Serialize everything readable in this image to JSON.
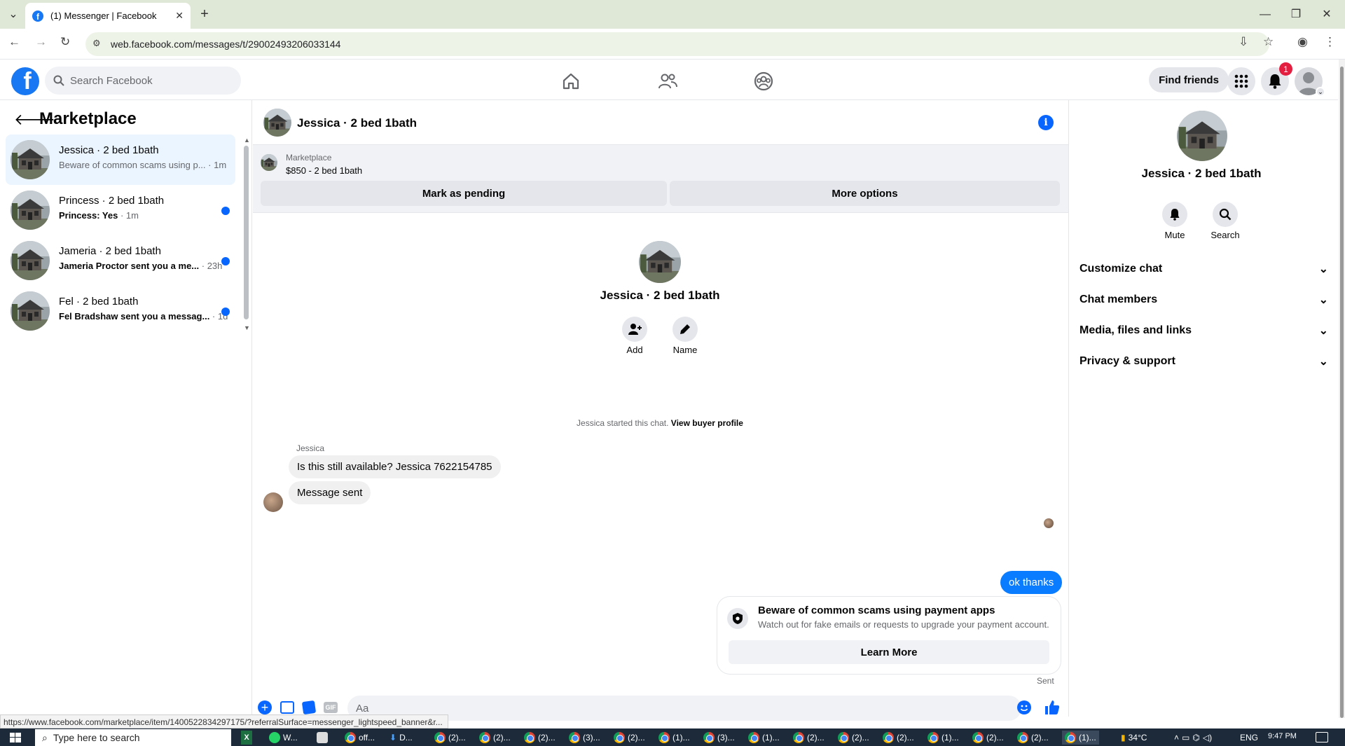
{
  "browser": {
    "tab_title": "(1) Messenger | Facebook",
    "url": "web.facebook.com/messages/t/29002493206033144",
    "status_url": "https://www.facebook.com/marketplace/item/1400522834297175/?referralSurface=messenger_lightspeed_banner&r..."
  },
  "header": {
    "search_placeholder": "Search Facebook",
    "find_friends": "Find friends",
    "notif_count": "1"
  },
  "left": {
    "title": "Marketplace",
    "conversations": [
      {
        "name": "Jessica · 2 bed 1bath",
        "snippet": "Beware of common scams using p...",
        "time": " · 1m",
        "unread": false
      },
      {
        "name": "Princess · 2 bed 1bath",
        "snippet": "Princess: Yes",
        "time": " · 1m",
        "unread": true
      },
      {
        "name": "Jameria · 2 bed 1bath",
        "snippet": "Jameria Proctor sent you a me...",
        "time": " · 23h",
        "unread": true
      },
      {
        "name": "Fel · 2 bed 1bath",
        "snippet": "Fel Bradshaw sent you a messag...",
        "time": " · 1d",
        "unread": true
      }
    ]
  },
  "chat": {
    "title": "Jessica · 2 bed 1bath",
    "banner_label": "Marketplace",
    "banner_listing": "$850 - 2 bed 1bath",
    "mark_pending": "Mark as pending",
    "more_options": "More options",
    "profile_name": "Jessica · 2 bed 1bath",
    "add_label": "Add",
    "name_label": "Name",
    "started_text": "Jessica started this chat.",
    "view_buyer": "View buyer profile",
    "sender": "Jessica",
    "msg1": "Is this still available? Jessica 7622154785",
    "msg2": "Message sent",
    "my_msg": "ok thanks",
    "scam_title": "Beware of common scams using payment apps",
    "scam_body": "Watch out for fake emails or requests to upgrade your payment account.",
    "learn_more": "Learn More",
    "sent": "Sent",
    "composer_placeholder": "Aa"
  },
  "right": {
    "name": "Jessica · 2 bed 1bath",
    "mute": "Mute",
    "search": "Search",
    "sections": [
      "Customize chat",
      "Chat members",
      "Media, files and links",
      "Privacy & support"
    ]
  },
  "taskbar": {
    "search_placeholder": "Type here to search",
    "apps": [
      "W...",
      "off...",
      "D...",
      "(2)...",
      "(2)...",
      "(2)...",
      "(3)...",
      "(2)...",
      "(1)...",
      "(3)...",
      "(1)...",
      "(2)...",
      "(2)...",
      "(2)...",
      "(1)...",
      "(2)...",
      "(2)...",
      "(1)..."
    ],
    "temp": "34°C",
    "lang": "ENG",
    "time": "9:47 PM"
  },
  "colors": {
    "brand": "#1877f2",
    "my_bubble": "#0a7cff",
    "badge": "#e41e3f",
    "unread_dot": "#0866ff"
  }
}
